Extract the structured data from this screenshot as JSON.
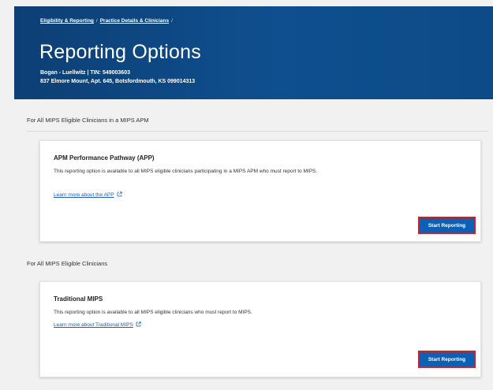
{
  "breadcrumb": {
    "items": [
      "Eligibility & Reporting",
      "Practice Details & Clinicians"
    ],
    "separator": "/"
  },
  "page": {
    "title": "Reporting Options",
    "practice_line1": "Bogan - Luellwitz | TIN: 549003603",
    "practice_line2": "837 Elmore Mount, Apt. 645, Botsfordmouth, KS 099014313"
  },
  "sections": [
    {
      "heading": "For All MIPS Eligible Clinicians in a MIPS APM",
      "card": {
        "title": "APM Performance Pathway (APP)",
        "description": "This reporting option is available to all MIPS eligible clinicians participating in a MIPS APM who must report to MIPS.",
        "link": "Learn more about the APP",
        "button": "Start Reporting"
      }
    },
    {
      "heading": "For All MIPS Eligible Clinicians",
      "card": {
        "title": "Traditional MIPS",
        "description": "This reporting option is available to all MIPS eligible clinicians who must report to MIPS.",
        "link": "Learn more about Traditional MIPS",
        "button": "Start Reporting"
      }
    }
  ],
  "icons": {
    "external_link": "external-link-icon"
  },
  "colors": {
    "header_bg": "#0d4a87",
    "button_bg": "#0f5fb3",
    "button_highlight_border": "#d21e1e",
    "link": "#1a5fb4",
    "page_bg": "#f1f1f1"
  }
}
